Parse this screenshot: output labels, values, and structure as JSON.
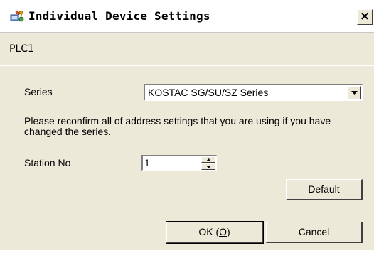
{
  "window": {
    "title": "Individual Device Settings",
    "close_glyph": "×"
  },
  "plc_name": "PLC1",
  "series": {
    "label": "Series",
    "selected": "KOSTAC SG/SU/SZ Series"
  },
  "note": "Please reconfirm all of address settings that you are using if you have changed the series.",
  "station": {
    "label": "Station No",
    "value": "1"
  },
  "buttons": {
    "default_label": "Default",
    "ok_label": "OK (",
    "ok_mnemonic": "O",
    "ok_suffix": ")",
    "cancel_label": "Cancel"
  },
  "icons": {
    "title": "device-settings-icon",
    "dropdown": "chevron-down-icon",
    "spin_up": "triangle-up-icon",
    "spin_down": "triangle-down-icon"
  }
}
